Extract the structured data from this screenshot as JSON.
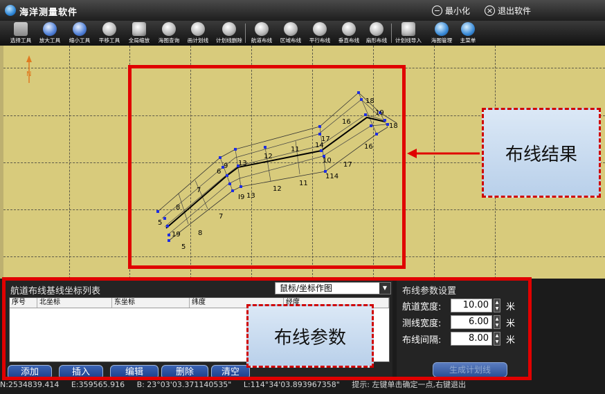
{
  "app": {
    "title": "海洋测量软件",
    "minimize": "最小化",
    "exit": "退出软件"
  },
  "toolbar": {
    "tools": [
      "选择工具",
      "放大工具",
      "缩小工具",
      "平移工具",
      "全局缩放",
      "海图查询",
      "画计划线",
      "计划线删除",
      "航道布线",
      "区域布线",
      "平行布线",
      "垂直布线",
      "扇形布线",
      "计划线导入",
      "海图管理",
      "主菜单"
    ]
  },
  "map": {
    "north_label": "N",
    "line_labels": [
      "18",
      "19",
      "18",
      "16",
      "16",
      "17",
      "14",
      "17",
      "10",
      "114",
      "11",
      "11",
      "12",
      "12",
      "13",
      "I9",
      "13",
      "9",
      "6",
      "7",
      "8",
      "7",
      "5",
      "19",
      "8",
      "5"
    ],
    "callout_result": "布线结果",
    "callout_params": "布线参数"
  },
  "list_panel": {
    "title": "航道布线基线坐标列表",
    "combo_value": "鼠标/坐标作图",
    "columns": [
      "序号",
      "北坐标",
      "东坐标",
      "纬度",
      "经度"
    ],
    "buttons": [
      "添加",
      "插入",
      "编辑",
      "删除",
      "清空"
    ]
  },
  "params": {
    "title": "布线参数设置",
    "rows": [
      {
        "label": "航道宽度:",
        "value": "10.00",
        "unit": "米"
      },
      {
        "label": "测线宽度:",
        "value": "6.00",
        "unit": "米"
      },
      {
        "label": "布线间隔:",
        "value": "8.00",
        "unit": "米"
      }
    ],
    "generate_button": "生成计划线"
  },
  "status": {
    "north": "N:2534839.414",
    "east": "E:359565.916",
    "lat": "B: 23°03'03.371140535\"",
    "lon": "L:114°34'03.893967358\"",
    "hint": "提示: 左键单击确定一点,右键退出"
  },
  "colors": {
    "map_bg": "#d8cb7c",
    "highlight_red": "#e00000",
    "route_line": "#000000",
    "vertex": "#1f2fe0",
    "button_blue": "#2a4d9c"
  }
}
